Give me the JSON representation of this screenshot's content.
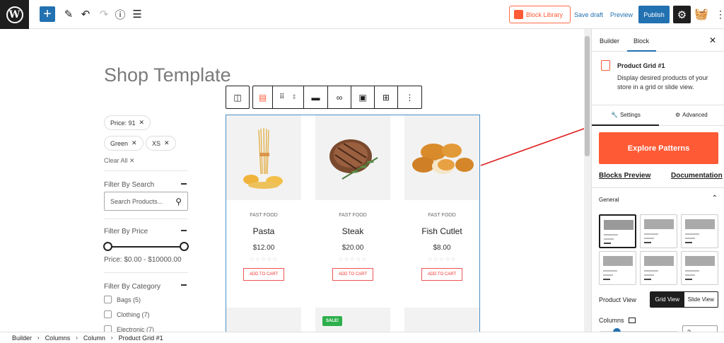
{
  "topbar": {
    "add_icon": "plus-icon",
    "block_library_label": "Block Library",
    "save_draft_label": "Save draft",
    "preview_label": "Preview",
    "publish_label": "Publish"
  },
  "page": {
    "title": "Shop Template"
  },
  "filters": {
    "active_chips": [
      "Price: 91",
      "Green",
      "XS"
    ],
    "clear_all": "Clear All",
    "search_heading": "Filter By Search",
    "search_placeholder": "Search Products...",
    "price_heading": "Filter By Price",
    "price_range_text": "Price: $0.00 - $10000.00",
    "category_heading": "Filter By Category",
    "categories": [
      {
        "label": "Bags",
        "count": "(5)"
      },
      {
        "label": "Clothing",
        "count": "(7)"
      },
      {
        "label": "Electronic",
        "count": "(7)"
      }
    ]
  },
  "products": [
    {
      "category": "FAST FOOD",
      "name": "Pasta",
      "price": "$12.00",
      "cta": "ADD TO CART"
    },
    {
      "category": "FAST FOOD",
      "name": "Steak",
      "price": "$20.00",
      "cta": "ADD TO CART"
    },
    {
      "category": "FAST FOOD",
      "name": "Fish Cutlet",
      "price": "$8.00",
      "cta": "ADD TO CART"
    }
  ],
  "sale_badge": "SALE!",
  "sidebar": {
    "tabs": [
      "Builder",
      "Block"
    ],
    "block_title": "Product Grid #1",
    "block_desc": "Display desired products of your store in a grid or slide view.",
    "settings_tab": "Settings",
    "advanced_tab": "Advanced",
    "explore_label": "Explore Patterns",
    "blocks_preview_link": "Blocks Preview",
    "documentation_link": "Documentation",
    "general_label": "General",
    "product_view_label": "Product View",
    "view_options": [
      "Grid View",
      "Slide View"
    ],
    "selected_view": "Grid View",
    "columns_label": "Columns",
    "columns_value": "3"
  },
  "breadcrumb": [
    "Builder",
    "Columns",
    "Column",
    "Product Grid #1"
  ],
  "colors": {
    "accent": "#2271b1",
    "brand": "#ff5a36",
    "sale": "#2eaf4d"
  }
}
